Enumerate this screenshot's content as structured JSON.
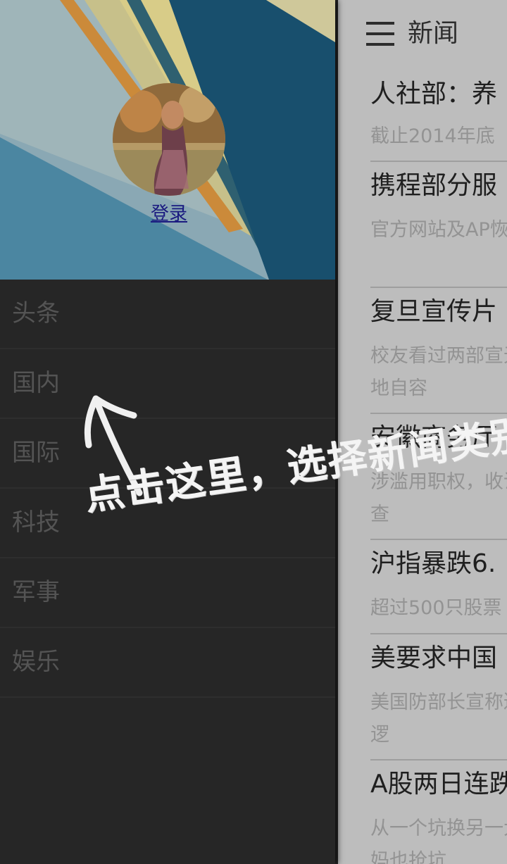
{
  "actionbar": {
    "title": "新闻",
    "menu_icon": "hamburger-menu-icon"
  },
  "drawer": {
    "login_label": "登录",
    "categories": [
      "头条",
      "国内",
      "国际",
      "科技",
      "军事",
      "娱乐"
    ]
  },
  "news": [
    {
      "title": "人社部：养",
      "desc": "截止2014年底"
    },
    {
      "title": "携程部分服",
      "desc": "官方网站及AP恢复"
    },
    {
      "title": "复旦宣传片",
      "desc": "校友看过两部宣无地自容"
    },
    {
      "title": "安徽商务厅",
      "desc": "涉滥用职权，收调查"
    },
    {
      "title": "沪指暴跌6.",
      "desc": "超过500只股票"
    },
    {
      "title": "美要求中国",
      "desc": "美国防部长宣称巡逻"
    },
    {
      "title": "A股两日连跌",
      "desc": "从一个坑换另一大妈也抢坑"
    }
  ],
  "annotation": {
    "text": "点击这里，选择新闻类别"
  },
  "colors": {
    "drawer_bg": "#262626",
    "content_bg": "#bdbdbd",
    "link": "#1a1a80"
  }
}
